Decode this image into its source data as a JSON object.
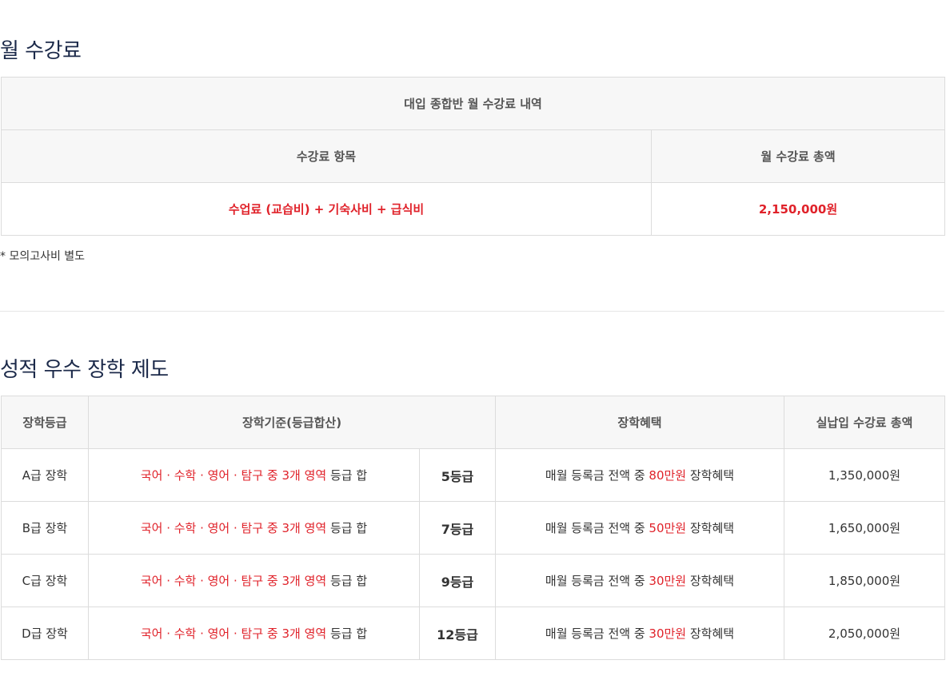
{
  "fee_section": {
    "title": "월 수강료",
    "table_caption": "대입 종합반 월 수강료 내역",
    "col_item": "수강료 항목",
    "col_total": "월 수강료 총액",
    "item_value": "수업료 (교습비) + 기숙사비 + 급식비",
    "total_value": "2,150,000원",
    "note": "* 모의고사비 별도"
  },
  "scholarship_section": {
    "title": "성적 우수 장학 제도",
    "headers": [
      "장학등급",
      "장학기준(등급합산)",
      "장학혜택",
      "실납입 수강료 총액"
    ],
    "rows": [
      {
        "level": "A급 장학",
        "criteria_red": "국어 · 수학 · 영어 · 탐구 중 3개 영역",
        "criteria_black": "등급 합",
        "grade": "5등급",
        "benefit_prefix": "매월 등록금 전액 중 ",
        "benefit_amount": "80만원",
        "benefit_suffix": " 장학혜택",
        "total": "1,350,000원"
      },
      {
        "level": "B급 장학",
        "criteria_red": "국어 · 수학 · 영어 · 탐구 중 3개 영역",
        "criteria_black": "등급 합",
        "grade": "7등급",
        "benefit_prefix": "매월 등록금 전액 중 ",
        "benefit_amount": "50만원",
        "benefit_suffix": " 장학혜택",
        "total": "1,650,000원"
      },
      {
        "level": "C급 장학",
        "criteria_red": "국어 · 수학 · 영어 · 탐구 중 3개 영역",
        "criteria_black": "등급 합",
        "grade": "9등급",
        "benefit_prefix": "매월 등록금 전액 중 ",
        "benefit_amount": "30만원",
        "benefit_suffix": " 장학혜택",
        "total": "1,850,000원"
      },
      {
        "level": "D급 장학",
        "criteria_red": "국어 · 수학 · 영어 · 탐구 중 3개 영역",
        "criteria_black": "등급 합",
        "grade": "12등급",
        "benefit_prefix": "매월 등록금 전액 중 ",
        "benefit_amount": "30만원",
        "benefit_suffix": " 장학혜택",
        "total": "2,050,000원"
      }
    ]
  },
  "colors": {
    "accent_red": "#e0222a",
    "title_navy": "#1c2a4a",
    "header_bg": "#f7f7f7",
    "border": "#dcdcdc"
  }
}
